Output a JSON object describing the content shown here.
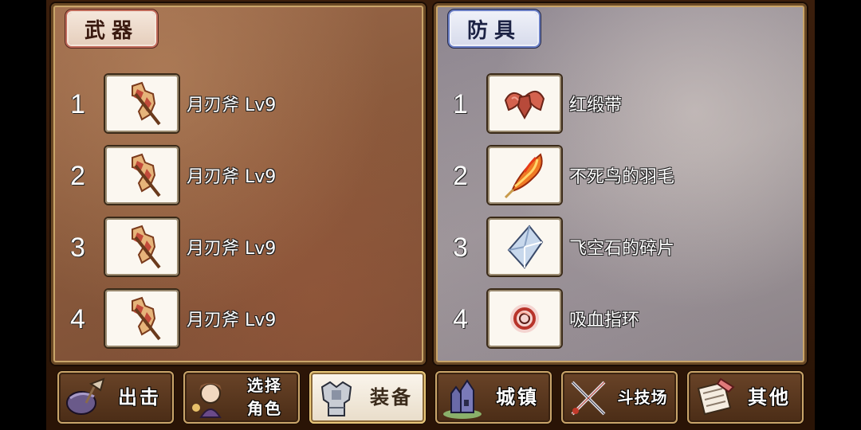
{
  "weapons": {
    "tab_label": "武器",
    "slots": [
      {
        "num": "1",
        "name": "月刃斧 Lv9",
        "icon": "moon-axe-icon"
      },
      {
        "num": "2",
        "name": "月刃斧 Lv9",
        "icon": "moon-axe-icon"
      },
      {
        "num": "3",
        "name": "月刃斧 Lv9",
        "icon": "moon-axe-icon"
      },
      {
        "num": "4",
        "name": "月刃斧 Lv9",
        "icon": "moon-axe-icon"
      }
    ]
  },
  "armor": {
    "tab_label": "防具",
    "slots": [
      {
        "num": "1",
        "name": "红缎带",
        "icon": "red-ribbon-icon"
      },
      {
        "num": "2",
        "name": "不死鸟的羽毛",
        "icon": "phoenix-feather-icon"
      },
      {
        "num": "3",
        "name": "飞空石的碎片",
        "icon": "crystal-shard-icon"
      },
      {
        "num": "4",
        "name": "吸血指环",
        "icon": "vampire-ring-icon"
      }
    ]
  },
  "nav": [
    {
      "label": "出击",
      "icon": "sortie-icon",
      "active": false
    },
    {
      "label": "选择角色",
      "line1": "选择",
      "line2": "角色",
      "icon": "character-icon",
      "active": false
    },
    {
      "label": "装备",
      "icon": "armor-icon",
      "active": true
    },
    {
      "label": "城镇",
      "icon": "castle-icon",
      "active": false
    },
    {
      "label": "斗技场",
      "icon": "arena-icon",
      "active": false
    },
    {
      "label": "其他",
      "icon": "scroll-icon",
      "active": false
    }
  ],
  "colors": {
    "weapons_tab_border": "#c06a5a",
    "armor_tab_border": "#6a7ec4",
    "frame_gold": "#c9a56a"
  }
}
